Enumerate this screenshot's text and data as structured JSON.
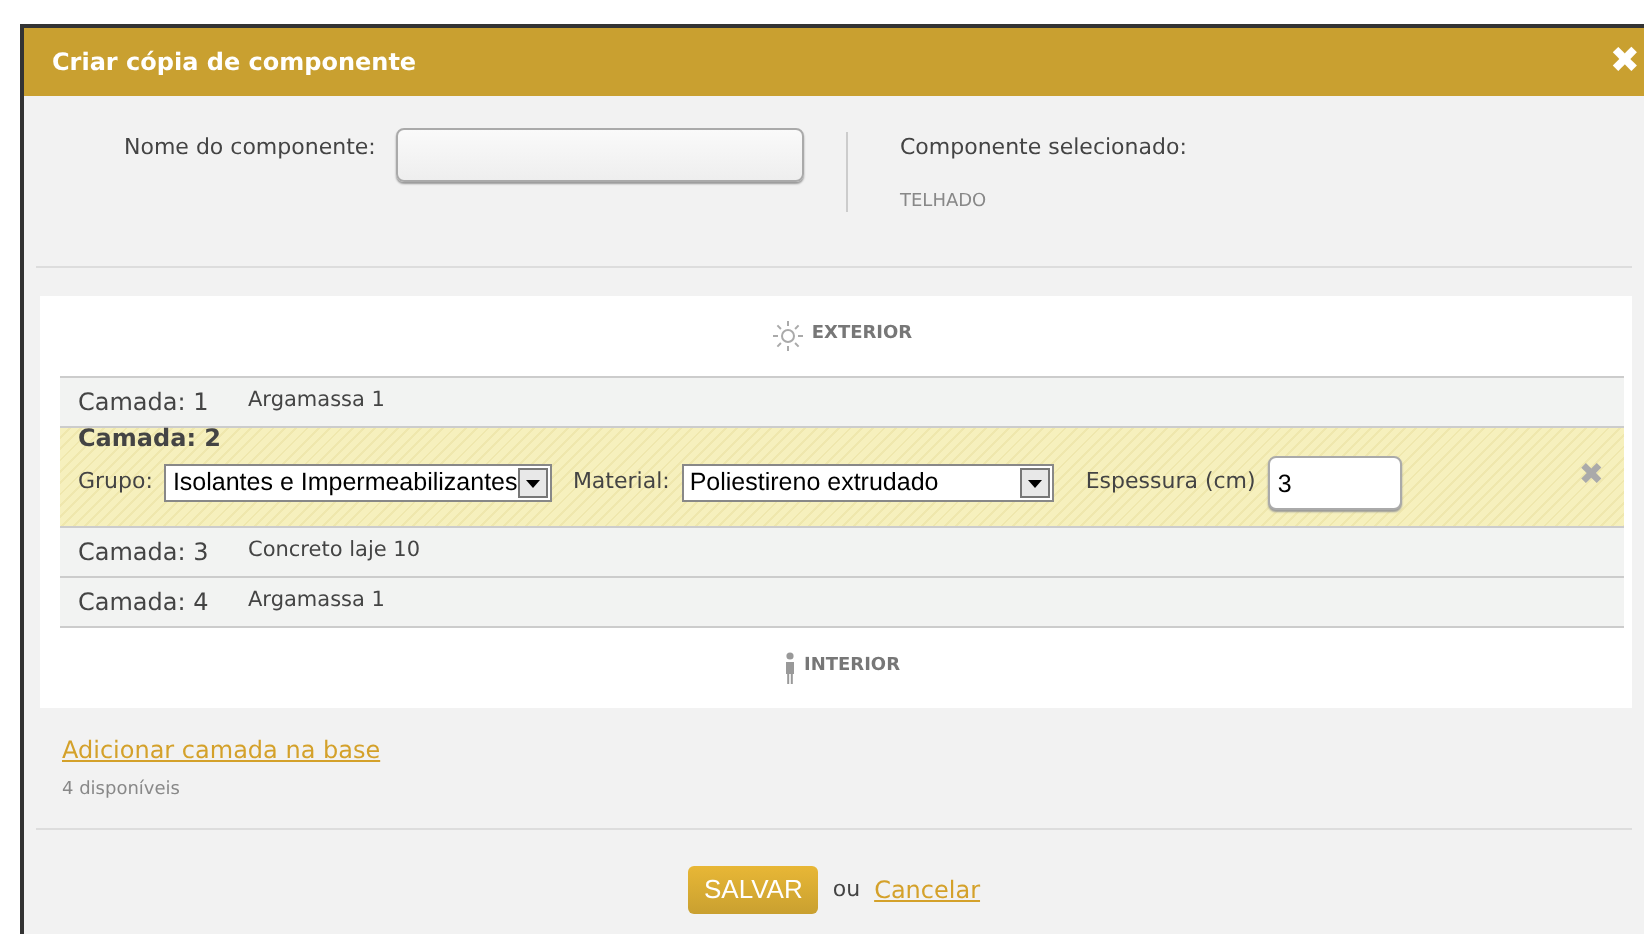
{
  "dialog": {
    "title": "Criar cópia de componente",
    "close": "✖"
  },
  "name_field": {
    "label": "Nome do componente:"
  },
  "selected_component": {
    "label": "Componente selecionado:",
    "value": "TELHADO"
  },
  "exterior": "EXTERIOR",
  "layers": [
    {
      "kind": "view",
      "label": "Camada: 1",
      "material": "Argamassa 1"
    },
    {
      "kind": "edit",
      "label": "Camada: 2",
      "group_label": "Grupo:",
      "group": "Isolantes e Impermeabilizantes",
      "material_label": "Material:",
      "material": "Poliestireno extrudado",
      "thickness_label": "Espessura (cm)",
      "thickness": "3",
      "remove": "✖"
    },
    {
      "kind": "view",
      "label": "Camada: 3",
      "material": "Concreto laje 10"
    },
    {
      "kind": "view",
      "label": "Camada: 4",
      "material": "Argamassa 1"
    }
  ],
  "interior": "INTERIOR",
  "add_link": "Adicionar camada na base",
  "available": "4 disponíveis",
  "save": "SALVAR",
  "or": "ou",
  "cancel": "Cancelar"
}
